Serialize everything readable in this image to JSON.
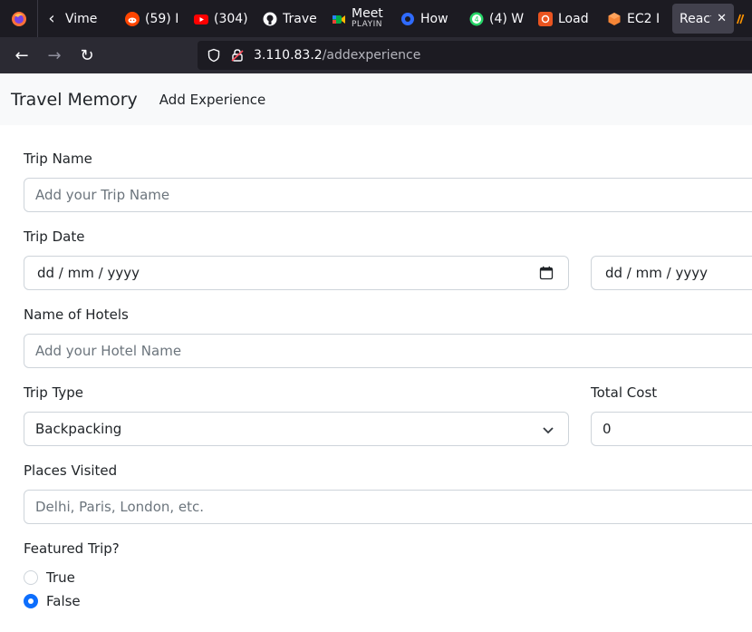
{
  "browser": {
    "tabs": [
      {
        "label": "Vime",
        "icon": "chevron-left-icon"
      },
      {
        "label": "(59) I",
        "icon": "reddit-icon",
        "color": "#ff4500"
      },
      {
        "label": "(304)",
        "icon": "youtube-icon",
        "color": "#ff0000"
      },
      {
        "label": "Trave",
        "icon": "github-icon",
        "color": "#fbfbfe"
      },
      {
        "label": "Meet",
        "sublabel": "PLAYIN",
        "icon": "meet-icon"
      },
      {
        "label": "How",
        "icon": "blue-app-icon",
        "color": "#2f6bff"
      },
      {
        "label": "(4) W",
        "icon": "whatsapp-icon",
        "color": "#25d366"
      },
      {
        "label": "Load",
        "icon": "ubuntu-load-icon",
        "color": "#e95420"
      },
      {
        "label": "EC2 I",
        "icon": "aws-ec2-icon",
        "color": "#f58536"
      },
      {
        "label": "React",
        "icon": "react-icon",
        "active": true
      }
    ],
    "url_host": "3.110.83.2",
    "url_path": "/addexperience"
  },
  "app": {
    "brand": "Travel Memory",
    "nav_link": "Add Experience"
  },
  "form": {
    "trip_name_label": "Trip Name",
    "trip_name_placeholder": "Add your Trip Name",
    "trip_date_label": "Trip Date",
    "start_date_placeholder": "dd / mm / yyyy",
    "end_date_placeholder": "dd / mm / yyyy",
    "hotels_label": "Name of Hotels",
    "hotels_placeholder": "Add your Hotel Name",
    "trip_type_label": "Trip Type",
    "trip_type_value": "Backpacking",
    "total_cost_label": "Total Cost",
    "total_cost_value": "0",
    "places_label": "Places Visited",
    "places_placeholder": "Delhi, Paris, London, etc.",
    "featured_label": "Featured Trip?",
    "featured_true": "True",
    "featured_false": "False",
    "featured_selected": "False"
  },
  "colors": {
    "accent": "#0d6efd",
    "border": "#ced4da",
    "placeholder": "#6c757d"
  }
}
